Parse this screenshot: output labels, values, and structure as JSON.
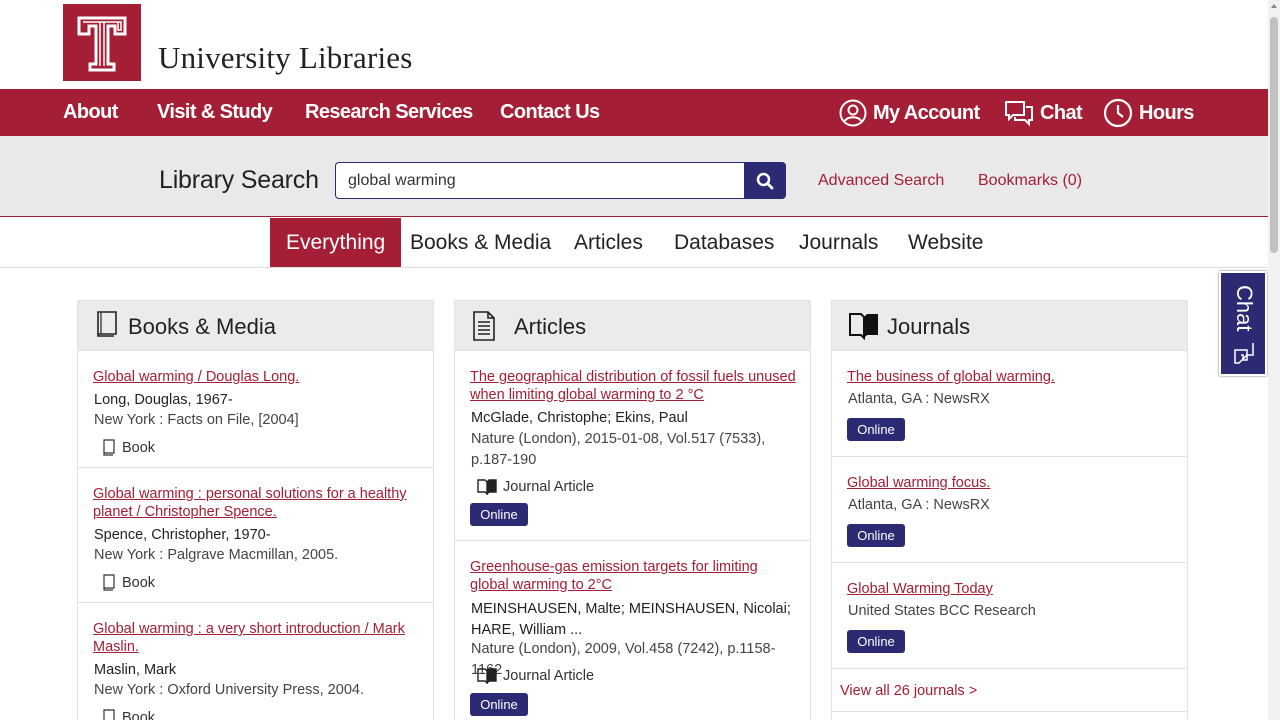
{
  "header": {
    "site_title": "University Libraries",
    "logo_icon": "temple-t-logo",
    "brand_color": "#a41e35",
    "accent_color": "#2b2a72"
  },
  "nav": {
    "links": [
      "About",
      "Visit & Study",
      "Research Services",
      "Contact Us"
    ],
    "account": "My Account",
    "chat": "Chat",
    "hours": "Hours"
  },
  "search": {
    "label": "Library Search",
    "value": "global warming",
    "advanced": "Advanced Search",
    "bookmarks": "Bookmarks (0)"
  },
  "tabs": [
    "Everything",
    "Books & Media",
    "Articles",
    "Databases",
    "Journals",
    "Website"
  ],
  "active_tab": "Everything",
  "chat_tab": "Chat",
  "books": {
    "heading": "Books & Media",
    "items": [
      {
        "title": "Global warming / Douglas Long.",
        "author": "Long, Douglas, 1967-",
        "pub": "New York : Facts on File, [2004]",
        "format": "Book"
      },
      {
        "title": "Global warming : personal solutions for a healthy planet / Christopher Spence.",
        "author": "Spence, Christopher, 1970-",
        "pub": "New York : Palgrave Macmillan, 2005.",
        "format": "Book"
      },
      {
        "title": "Global warming : a very short introduction / Mark Maslin.",
        "author": "Maslin, Mark",
        "pub": "New York : Oxford University Press, 2004.",
        "format": "Book"
      }
    ]
  },
  "articles": {
    "heading": "Articles",
    "items": [
      {
        "title": "The geographical distribution of fossil fuels unused when limiting global warming to 2 °C",
        "author": "McGlade, Christophe; Ekins, Paul",
        "pub": "Nature (London), 2015-01-08, Vol.517 (7533), p.187-190",
        "format": "Journal Article",
        "button": "Online"
      },
      {
        "title": "Greenhouse-gas emission targets for limiting global warming to 2°C",
        "author": "MEINSHAUSEN, Malte; MEINSHAUSEN, Nicolai; HARE, William ...",
        "pub": "Nature (London), 2009, Vol.458 (7242), p.1158-1162",
        "format": "Journal Article",
        "button": "Online"
      }
    ]
  },
  "journals": {
    "heading": "Journals",
    "items": [
      {
        "title": "The business of global warming.",
        "pub": "Atlanta, GA : NewsRX",
        "button": "Online"
      },
      {
        "title": "Global warming focus.",
        "pub": "Atlanta, GA : NewsRX",
        "button": "Online"
      },
      {
        "title": "Global Warming Today",
        "pub": "United States BCC Research",
        "button": "Online"
      }
    ],
    "view_all": "View all 26 journals >"
  }
}
